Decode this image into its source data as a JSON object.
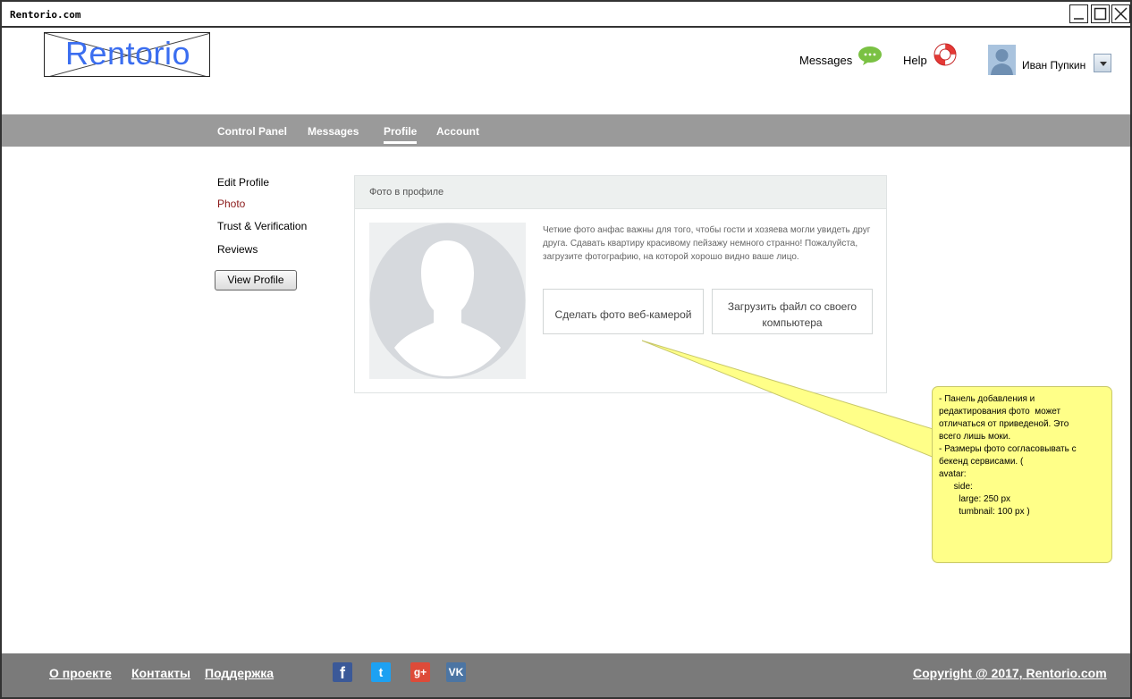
{
  "window": {
    "title": "Rentorio.com"
  },
  "header": {
    "logo_text": "Rentorio",
    "messages_label": "Messages",
    "help_label": "Help",
    "user_name": "Иван Пупкин"
  },
  "nav": {
    "items": [
      {
        "label": "Control Panel"
      },
      {
        "label": "Messages"
      },
      {
        "label": "Profile"
      },
      {
        "label": "Account"
      }
    ],
    "active": "Profile"
  },
  "sidebar": {
    "items": [
      {
        "label": "Edit Profile"
      },
      {
        "label": "Photo"
      },
      {
        "label": "Trust & Verification"
      },
      {
        "label": "Reviews"
      }
    ],
    "active": "Photo",
    "view_profile_label": "View Profile"
  },
  "panel": {
    "title": "Фото в профиле",
    "description": "Четкие фото анфас важны для того, чтобы гости и хозяева могли увидеть друг друга. Сдавать квартиру красивому пейзажу немного странно! Пожалуйста, загрузите фотографию, на которой хорошо видно ваше лицо.",
    "webcam_button": "Сделать фото веб-камерой",
    "upload_button": "Загрузить файл со своего компьютера"
  },
  "note": {
    "text": "- Панель добавления и \nредактирования фото  может \nотличаться от приведеной. Это \nвсего лишь моки.\n- Размеры фото согласовывать с \nбекенд сервисами. (\navatar:\n      side:\n        large: 250 px\n        tumbnail: 100 px )"
  },
  "footer": {
    "links": [
      {
        "label": "О проекте"
      },
      {
        "label": "Контакты"
      },
      {
        "label": "Поддержка"
      }
    ],
    "social": {
      "facebook": "f",
      "twitter": "t",
      "googleplus": "g+",
      "vk": "VK"
    },
    "copyright": "Copyright @ 2017, Rentorio.com"
  },
  "colors": {
    "navbar": "#9a9a9a",
    "footer": "#7a7a7a",
    "logo": "#3b6ef0",
    "active_sidebar": "#8b1a1a",
    "note": "#ffff88"
  }
}
